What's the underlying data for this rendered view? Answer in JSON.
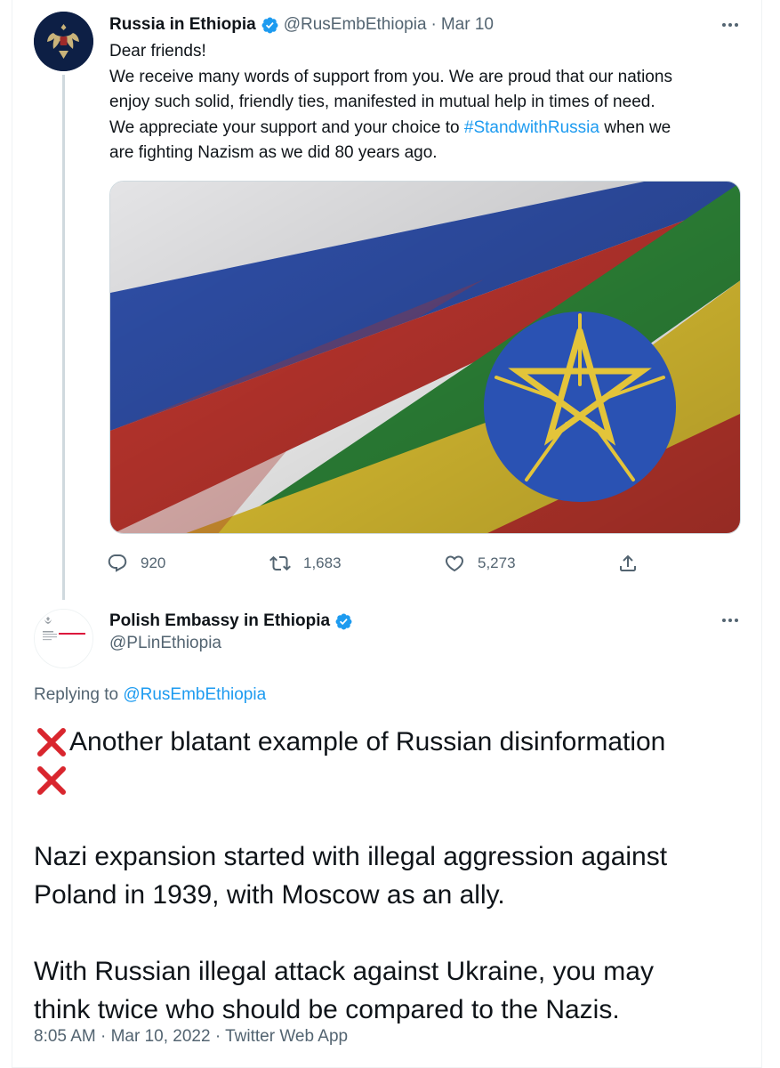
{
  "parent_tweet": {
    "author_name": "Russia in Ethiopia",
    "handle": "@RusEmbEthiopia",
    "date": "Mar 10",
    "text_lines": [
      "Dear friends!",
      "We receive many words of support from you. We are proud that our nations",
      "enjoy such solid, friendly ties, manifested in mutual help in times of need.",
      "We appreciate your support and your choice to ",
      "are fighting Nazism as we did 80 years ago."
    ],
    "hashtag": "#StandwithRussia",
    "after_hashtag": " when we",
    "image_icon": "russia-ethiopia-flags-image",
    "replies": "920",
    "retweets": "1,683",
    "likes": "5,273"
  },
  "reply_tweet": {
    "author_name": "Polish Embassy in Ethiopia",
    "handle": "@PLinEthiopia",
    "replying_prefix": "Replying to ",
    "replying_to": "@RusEmbEthiopia",
    "body_line_1": "Another blatant example of Russian disinformation",
    "body_line_2": "Nazi expansion started with illegal aggression against",
    "body_line_3": "Poland in 1939, with Moscow as an ally.",
    "body_line_4": "With Russian illegal attack against Ukraine, you may",
    "body_line_5": "think twice who should be compared to the Nazis.",
    "timestamp": "8:05 AM · Mar 10, 2022 · Twitter Web App"
  },
  "colors": {
    "accent": "#1d9bf0",
    "secondary_text": "#536471",
    "cross_mark": "#d9262e"
  }
}
